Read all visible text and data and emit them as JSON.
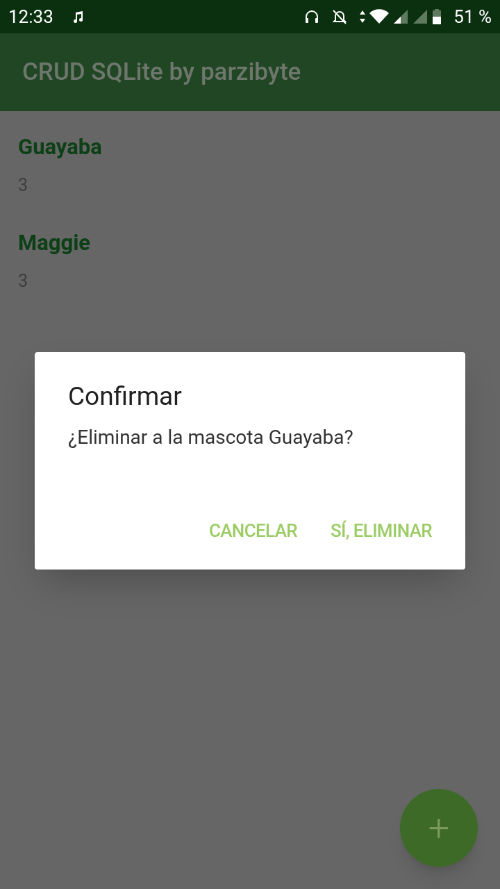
{
  "status_bar": {
    "time": "12:33",
    "battery": "51 %"
  },
  "app_bar": {
    "title": "CRUD SQLite by parzibyte"
  },
  "pets": [
    {
      "name": "Guayaba",
      "age": "3"
    },
    {
      "name": "Maggie",
      "age": "3"
    }
  ],
  "dialog": {
    "title": "Confirmar",
    "message": "¿Eliminar a la mascota Guayaba?",
    "buttons": [
      "CANCELAR",
      "SÍ, ELIMINAR"
    ]
  },
  "fab": {
    "label": "+"
  }
}
